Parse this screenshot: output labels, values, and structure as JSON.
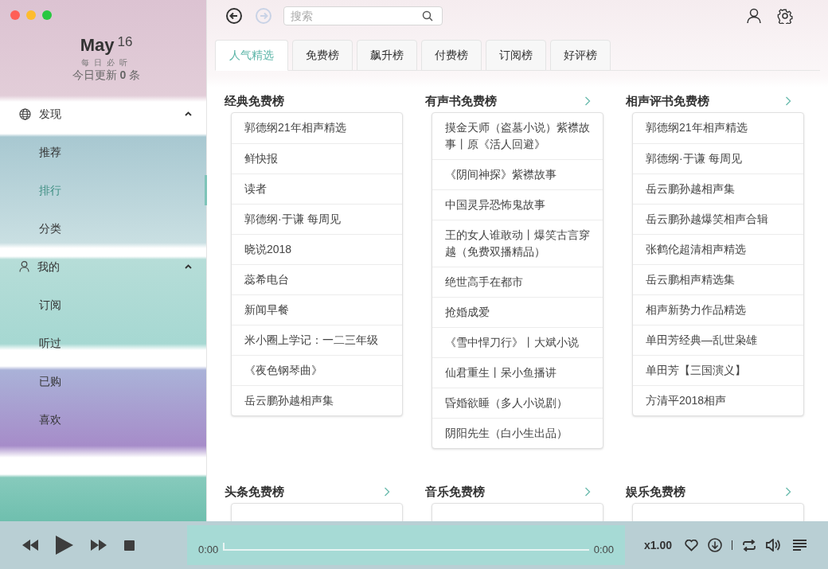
{
  "sidebar": {
    "header": {
      "month": "May",
      "day": "16",
      "tagline": "每日必听",
      "update": "今日更新 **0** 条"
    },
    "sections": [
      {
        "label": "发现",
        "expanded": true,
        "items": [
          {
            "label": "推荐",
            "selected": false
          },
          {
            "label": "排行",
            "selected": true
          },
          {
            "label": "分类",
            "selected": false
          }
        ]
      },
      {
        "label": "我的",
        "expanded": true,
        "items": [
          {
            "label": "订阅",
            "selected": false
          },
          {
            "label": "听过",
            "selected": false
          },
          {
            "label": "已购",
            "selected": false
          },
          {
            "label": "喜欢",
            "selected": false
          }
        ]
      }
    ]
  },
  "toolbar": {
    "back_disabled": false,
    "forward_disabled": true,
    "search": {
      "placeholder": "搜索"
    }
  },
  "tabs": [
    {
      "label": "人气精选",
      "selected": true
    },
    {
      "label": "免费榜",
      "selected": false
    },
    {
      "label": "飙升榜",
      "selected": false
    },
    {
      "label": "付费榜",
      "selected": false
    },
    {
      "label": "订阅榜",
      "selected": false
    },
    {
      "label": "好评榜",
      "selected": false
    }
  ],
  "charts": [
    {
      "title": "经典免费榜",
      "more": false,
      "items": [
        "郭德纲21年相声精选",
        "鲜快报",
        "读者",
        "郭德纲·于谦 每周见",
        "晓说2018",
        "蕊希电台",
        "新闻早餐",
        "米小圈上学记：一二三年级",
        "《夜色钢琴曲》",
        "岳云鹏孙越相声集"
      ]
    },
    {
      "title": "有声书免费榜",
      "more": true,
      "items": [
        "摸金天师（盗墓小说）紫襟故事丨原《活人回避》",
        "《阴间神探》紫襟故事",
        "中国灵异恐怖鬼故事",
        "王的女人谁敢动丨爆笑古言穿越（免费双播精品）",
        "绝世高手在都市",
        "抢婚成爱",
        "《雪中悍刀行》丨大斌小说",
        "仙君重生丨呆小鱼播讲",
        "昏婚欲睡（多人小说剧）",
        "阴阳先生（白小生出品）"
      ]
    },
    {
      "title": "相声评书免费榜",
      "more": true,
      "items": [
        "郭德纲21年相声精选",
        "郭德纲·于谦 每周见",
        "岳云鹏孙越相声集",
        "岳云鹏孙越爆笑相声合辑",
        "张鹤伦超清相声精选",
        "岳云鹏相声精选集",
        "相声新势力作品精选",
        "单田芳经典—乱世枭雄",
        "单田芳【三国演义】",
        "方清平2018相声"
      ]
    },
    {
      "title": "头条免费榜",
      "more": true
    },
    {
      "title": "音乐免费榜",
      "more": true
    },
    {
      "title": "娱乐免费榜",
      "more": true
    }
  ],
  "player": {
    "elapsed": "0:00",
    "duration": "0:00",
    "level": 0,
    "speed": "x1.00"
  }
}
